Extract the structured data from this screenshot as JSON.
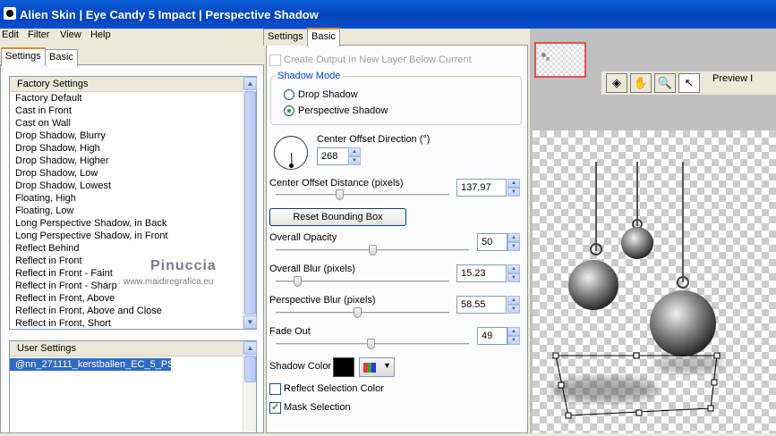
{
  "title": "Alien Skin | Eye Candy 5 Impact | Perspective Shadow",
  "menu": [
    "Edit",
    "Filter",
    "View",
    "Help"
  ],
  "left_tabs": [
    "Settings",
    "Basic"
  ],
  "factory": {
    "header": "Factory Settings",
    "items": [
      "Factory Default",
      "Cast in Front",
      "Cast on Wall",
      "Drop Shadow, Blurry",
      "Drop Shadow, High",
      "Drop Shadow, Higher",
      "Drop Shadow, Low",
      "Drop Shadow, Lowest",
      "Floating, High",
      "Floating, Low",
      "Long Perspective Shadow, in Back",
      "Long Perspective Shadow, in Front",
      "Reflect Behind",
      "Reflect in Front",
      "Reflect in Front - Faint",
      "Reflect in Front - Sharp",
      "Reflect in Front, Above",
      "Reflect in Front, Above and Close",
      "Reflect in Front, Short"
    ]
  },
  "user": {
    "header": "User Settings",
    "items": [
      "@nn_271111_kerstballen_EC_5_PS"
    ]
  },
  "watermark": {
    "line1": "Pinuccia",
    "line2": "www.maidiregrafica.eu"
  },
  "right_tabs": [
    "Settings",
    "Basic"
  ],
  "basic": {
    "create_output": "Create Output In New Layer Below Current",
    "shadow_mode_label": "Shadow Mode",
    "drop_shadow": "Drop Shadow",
    "perspective_shadow": "Perspective Shadow",
    "direction_label": "Center Offset Direction (°)",
    "direction_value": "268",
    "distance_label": "Center Offset Distance (pixels)",
    "distance_value": "137.97",
    "reset_label": "Reset Bounding Box",
    "opacity_label": "Overall Opacity",
    "opacity_value": "50",
    "blur_label": "Overall Blur (pixels)",
    "blur_value": "15.23",
    "pblur_label": "Perspective Blur (pixels)",
    "pblur_value": "58.55",
    "fade_label": "Fade Out",
    "fade_value": "49",
    "shadow_color_label": "Shadow Color",
    "shadow_color": "#000000",
    "reflect_label": "Reflect Selection Color",
    "mask_label": "Mask Selection"
  },
  "preview_label": "Preview I",
  "tools": [
    "palette-icon",
    "hand-icon",
    "zoom-icon",
    "arrow-icon"
  ]
}
